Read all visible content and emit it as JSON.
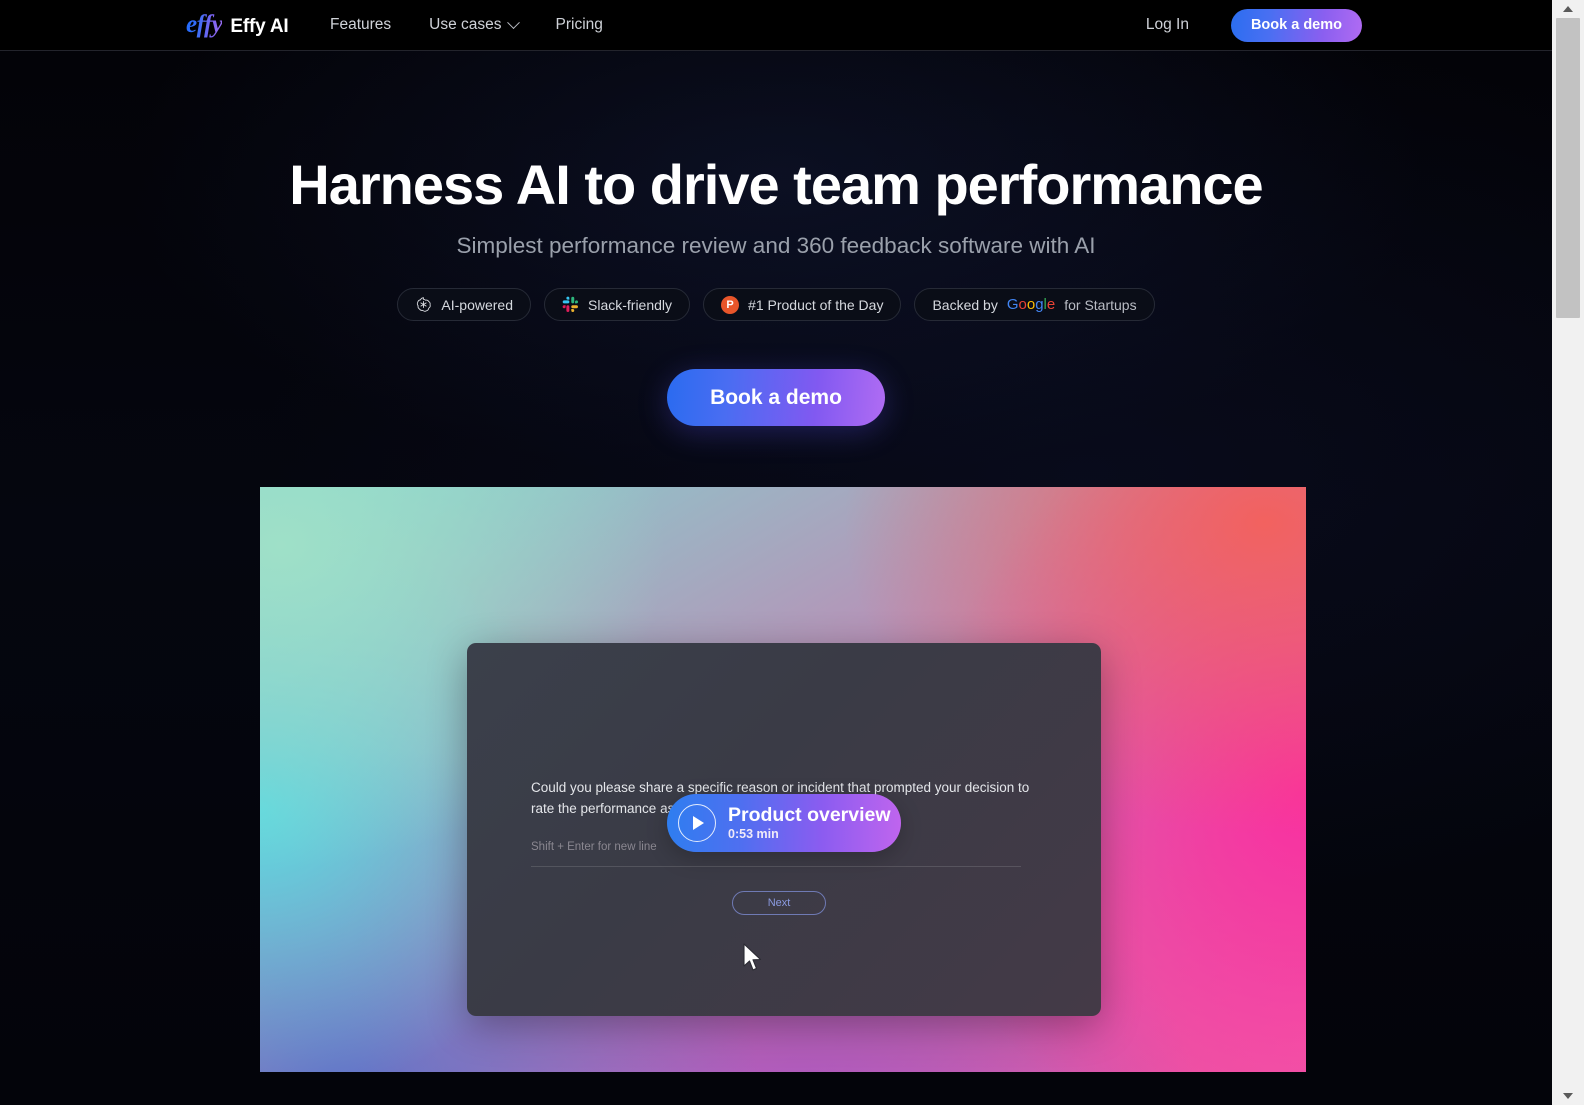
{
  "nav": {
    "logo_mark": "effy",
    "logo_word": "Effy AI",
    "links": [
      {
        "label": "Features",
        "has_chevron": false
      },
      {
        "label": "Use cases",
        "has_chevron": true
      },
      {
        "label": "Pricing",
        "has_chevron": false
      }
    ],
    "login_label": "Log In",
    "demo_label": "Book a demo"
  },
  "hero": {
    "title": "Harness AI to drive team performance",
    "subtitle": "Simplest performance review and 360 feedback software with AI",
    "cta_label": "Book a demo",
    "badges": [
      {
        "icon": "openai-icon",
        "label": "AI-powered"
      },
      {
        "icon": "slack-icon",
        "label": "Slack-friendly"
      },
      {
        "icon": "product-hunt-icon",
        "badge_letter": "P",
        "label": "#1 Product of the Day"
      },
      {
        "icon": "google-icon",
        "prefix": "Backed by",
        "brand": "Google",
        "suffix": "for Startups"
      }
    ]
  },
  "showcase": {
    "question_text": "Could you please share a specific reason or incident that prompted your decision to rate the performance as 'Exceptional'?",
    "input_hint": "Shift + Enter for new line",
    "next_label": "Next",
    "play_title": "Product overview",
    "play_duration": "0:53 min"
  },
  "colors": {
    "accent_blue": "#2a6bf0",
    "accent_purple": "#b06cf3",
    "page_background": "#030308",
    "nav_background": "#000000",
    "product_hunt_orange": "#e8552a",
    "google_blue": "#4285f4",
    "google_red": "#ea4335",
    "google_yellow": "#fbbc05",
    "google_green": "#34a853"
  }
}
